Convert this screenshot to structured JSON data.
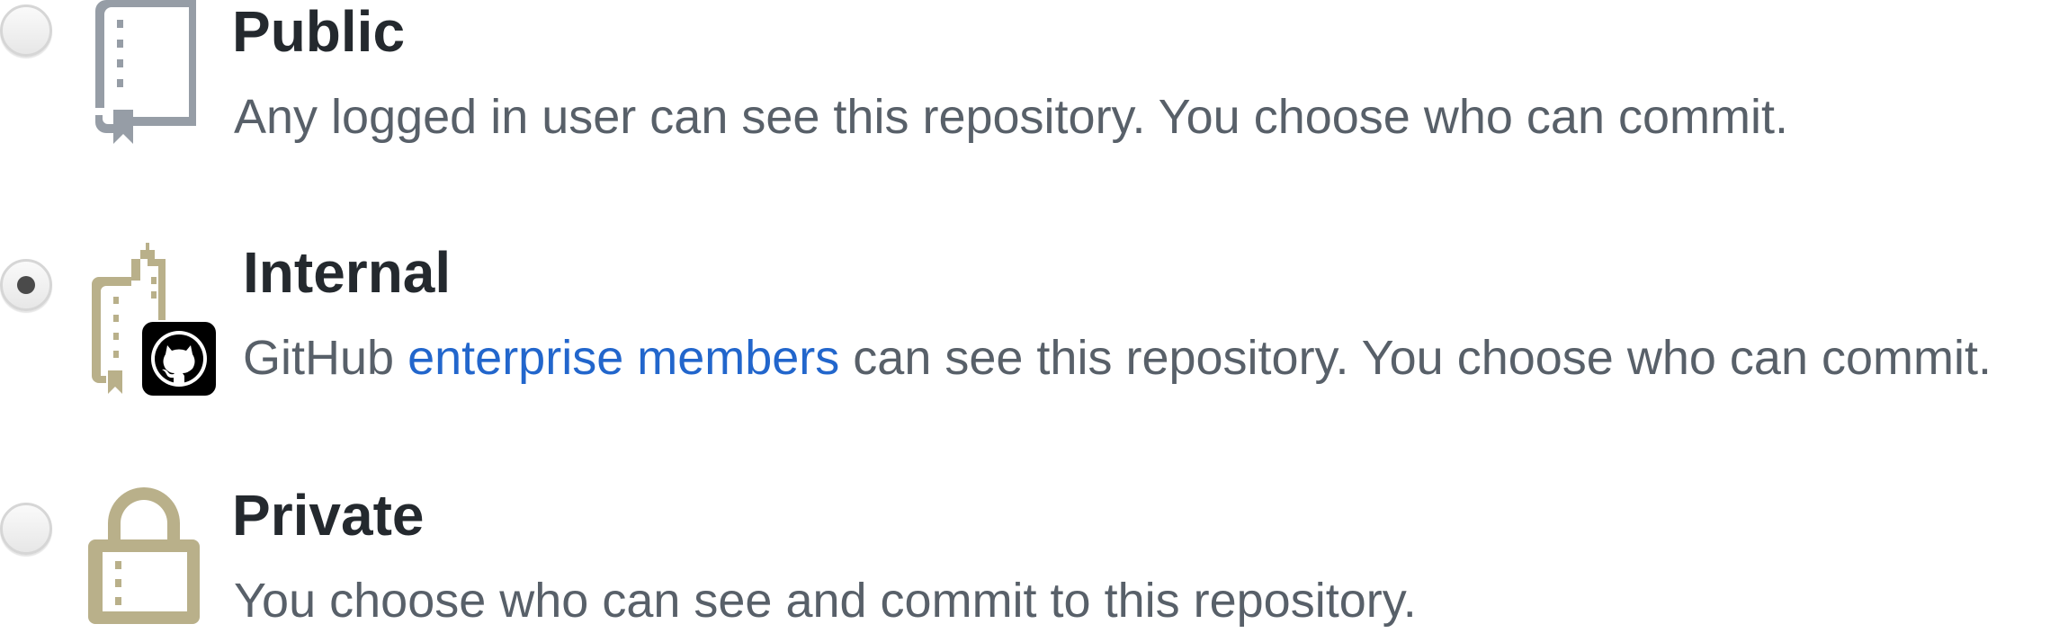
{
  "options": [
    {
      "id": "public",
      "title": "Public",
      "description": "Any logged in user can see this repository. You choose who can commit.",
      "selected": false,
      "icon": "repo-book-icon"
    },
    {
      "id": "internal",
      "title": "Internal",
      "description_prefix": "GitHub",
      "description_link": "enterprise members",
      "description_suffix": "can see this repository. You choose who can commit.",
      "selected": true,
      "icon": "internal-repo-building-icon",
      "badge_icon": "github-octocat-icon"
    },
    {
      "id": "private",
      "title": "Private",
      "description": "You choose who can see and commit to this repository.",
      "selected": false,
      "icon": "lock-icon"
    }
  ],
  "colors": {
    "title": "#24292e",
    "description": "#586069",
    "link": "#2266cc",
    "public_icon": "#969da6",
    "internal_icon": "#b9b08a",
    "private_icon": "#b9b08a"
  }
}
